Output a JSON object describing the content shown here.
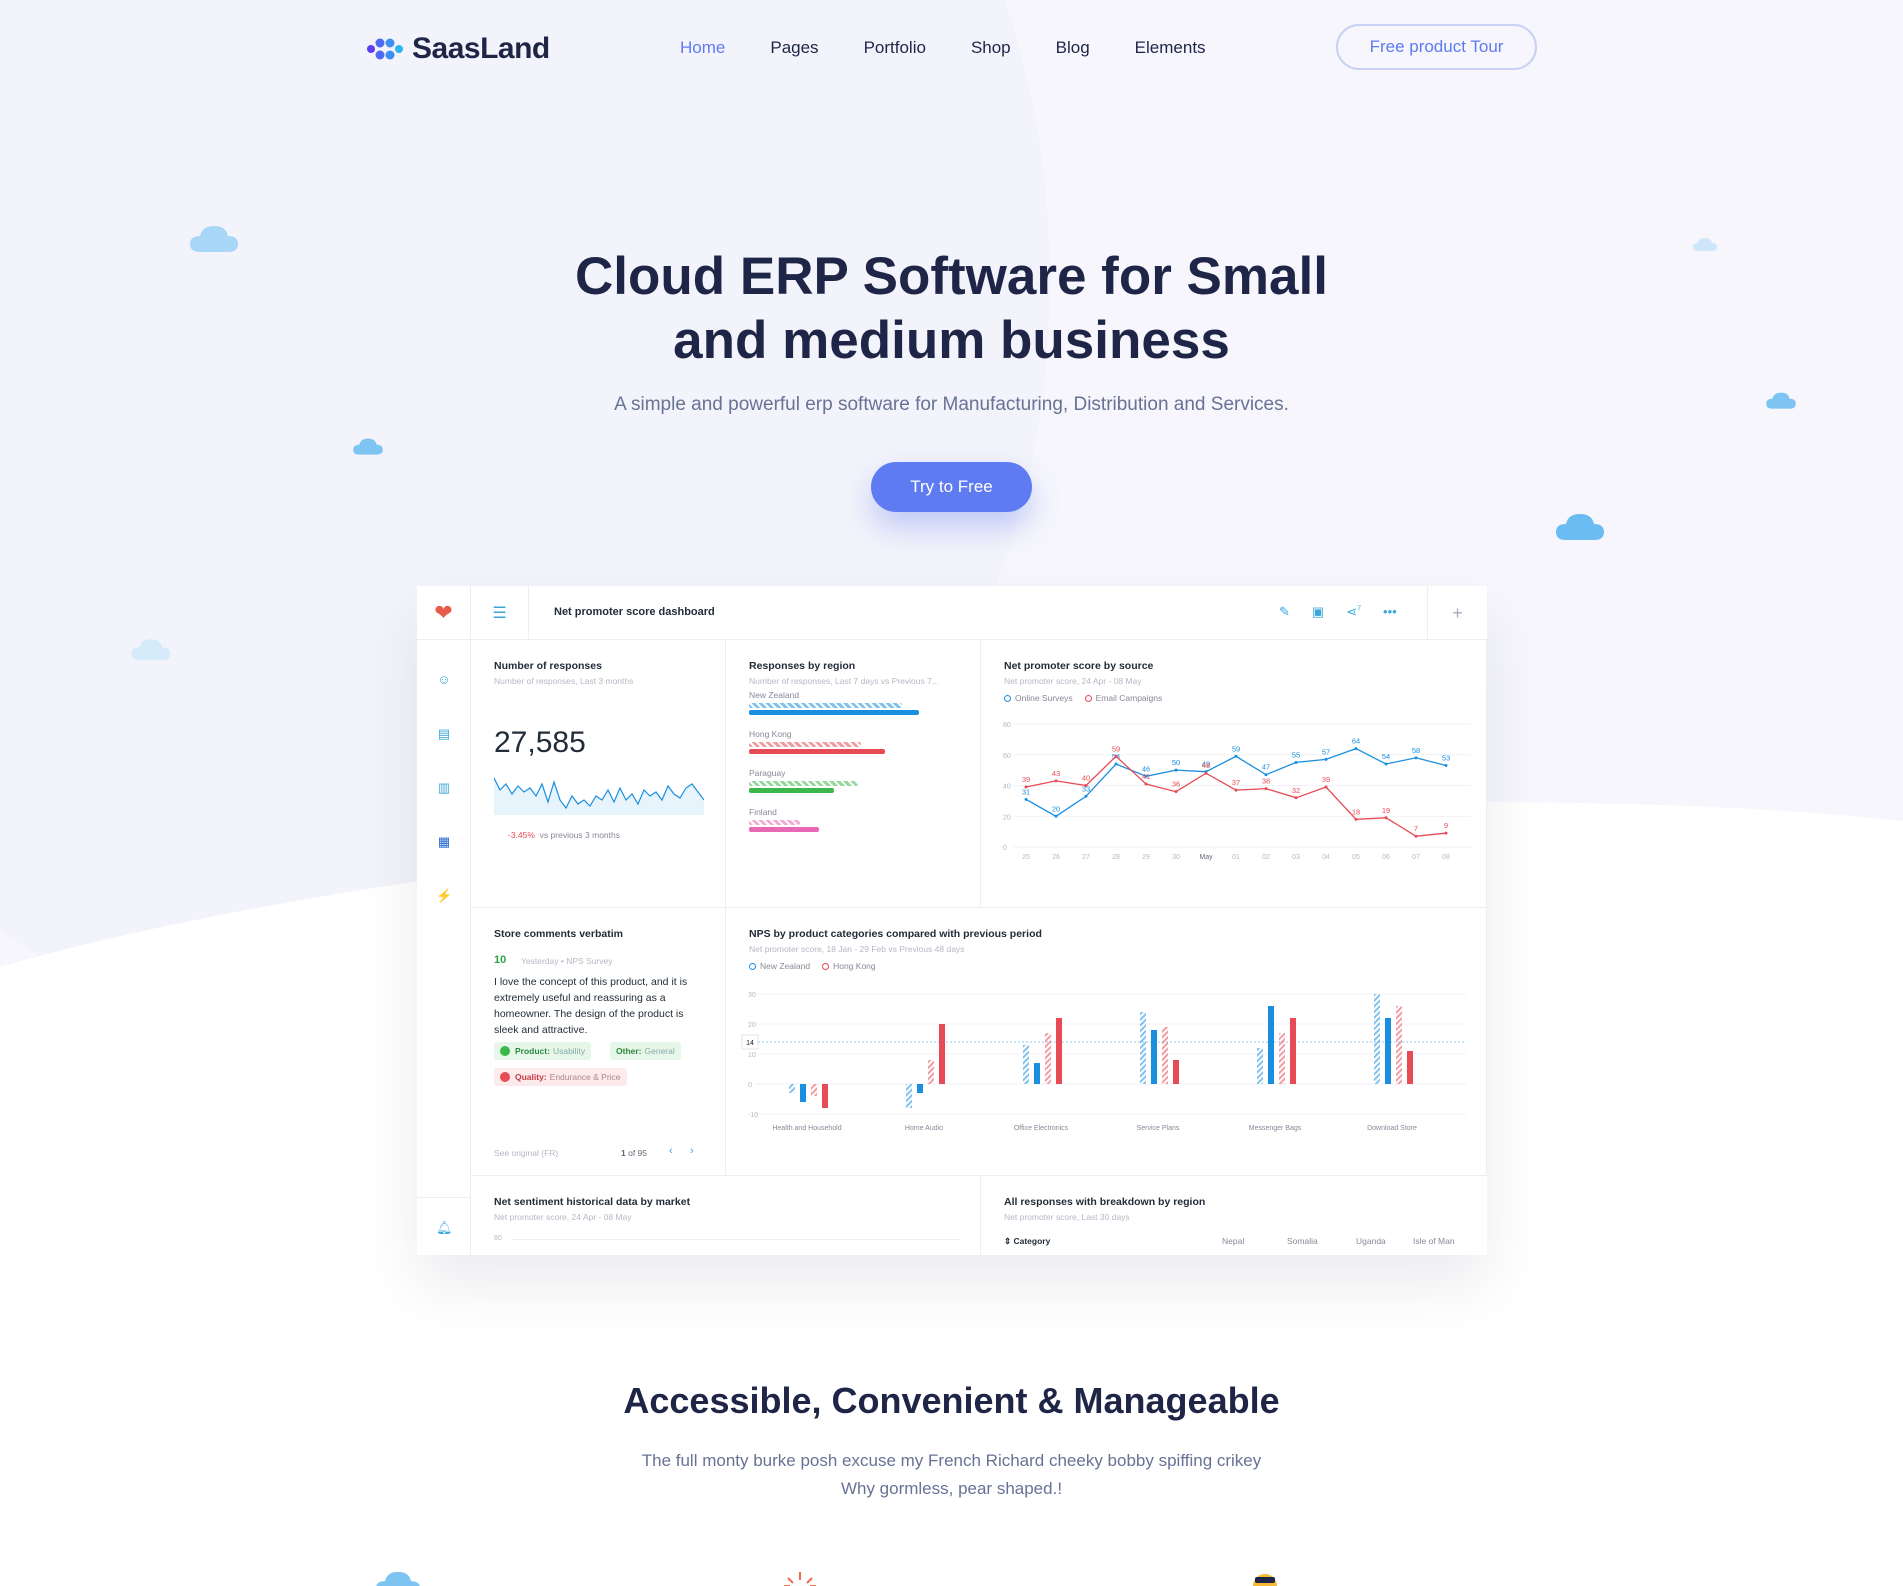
{
  "nav": {
    "brand": "SaasLand",
    "items": [
      {
        "label": "Home",
        "active": true
      },
      {
        "label": "Pages"
      },
      {
        "label": "Portfolio"
      },
      {
        "label": "Shop"
      },
      {
        "label": "Blog"
      },
      {
        "label": "Elements"
      }
    ],
    "cta": "Free product Tour"
  },
  "hero": {
    "title_line1": "Cloud ERP Software for Small",
    "title_line2": "and medium business",
    "subtitle": "A simple and powerful erp software for Manufacturing, Distribution and Services.",
    "button": "Try to Free"
  },
  "dashboard": {
    "title": "Net promoter score dashboard",
    "share_count": "7",
    "responses": {
      "title": "Number of responses",
      "subtitle": "Number of responses, Last 3 months",
      "value": "27,585",
      "delta": "-3.45%",
      "delta_text": "vs previous 3 months"
    },
    "regions": {
      "title": "Responses by region",
      "subtitle": "Number of responses, Last 7 days vs Previous 7...",
      "items": [
        {
          "label": "New Zealand",
          "color": "#1a8fe0",
          "value": 1.0,
          "prev": 0.9
        },
        {
          "label": "Hong Kong",
          "color": "#e84b55",
          "value": 0.8,
          "prev": 0.66
        },
        {
          "label": "Paraguay",
          "color": "#3cb84a",
          "value": 0.5,
          "prev": 0.64
        },
        {
          "label": "Finland",
          "color": "#e868b5",
          "value": 0.41,
          "prev": 0.3
        }
      ]
    },
    "nps_source": {
      "title": "Net promoter score by source",
      "subtitle": "Net promoter score, 24 Apr - 08 May",
      "legend": [
        "Online Surveys",
        "Email Campaigns"
      ]
    },
    "comments": {
      "title": "Store comments verbatim",
      "score": "10",
      "meta": "Yesterday  •  NPS Survey",
      "text": "I love the concept of this product, and it is extremely useful and reassuring as a homeowner. The design of the product is sleek and attractive.",
      "tags": [
        {
          "key": "Product:",
          "value": "Usability"
        },
        {
          "key": "Other:",
          "value": "General"
        },
        {
          "key": "Quality:",
          "value": "Endurance & Price"
        }
      ],
      "see_original": "See original (FR)",
      "page": "1",
      "page_total": "of 95"
    },
    "nps_categories": {
      "title": "NPS by product categories compared with previous period",
      "subtitle": "Net promoter score, 18 Jan - 29 Feb vs Previous 48 days",
      "legend": [
        "New Zealand",
        "Hong Kong"
      ]
    },
    "sentiment": {
      "title": "Net sentiment historical data by market",
      "subtitle": "Net promoter score, 24 Apr - 08 May",
      "tick": "80"
    },
    "breakdown": {
      "title": "All responses with breakdown by region",
      "subtitle": "Net promoter score, Last 30 days",
      "columns": [
        "Category",
        "Nepal",
        "Somalia",
        "Uganda",
        "Isle of Man"
      ]
    }
  },
  "section2": {
    "title": "Accessible, Convenient & Manageable",
    "subtitle_line1": "The full monty burke posh excuse my French Richard cheeky bobby spiffing crikey",
    "subtitle_line2": "Why gormless, pear shaped.!"
  },
  "chart_data": [
    {
      "type": "line",
      "title": "Net promoter score by source",
      "x": [
        "25",
        "26",
        "27",
        "28",
        "29",
        "30",
        "May",
        "01",
        "02",
        "03",
        "04",
        "05",
        "06",
        "07",
        "08"
      ],
      "ylim": [
        0,
        80
      ],
      "yticks": [
        0,
        20,
        40,
        60,
        80
      ],
      "series": [
        {
          "name": "Online Surveys",
          "color": "#1a8fe0",
          "values": [
            31,
            20,
            33,
            54,
            46,
            50,
            49,
            59,
            47,
            55,
            57,
            64,
            54,
            58,
            53
          ]
        },
        {
          "name": "Email Campaigns",
          "color": "#e84b55",
          "values": [
            39,
            43,
            40,
            59,
            41,
            36,
            48,
            37,
            38,
            32,
            39,
            18,
            19,
            7,
            9
          ]
        }
      ]
    },
    {
      "type": "bar",
      "title": "NPS by product categories compared with previous period",
      "categories": [
        "Health and Household",
        "Home Audio",
        "Office Electronics",
        "Service Plans",
        "Messenger Bags",
        "Download Store"
      ],
      "ylim": [
        -10,
        30
      ],
      "yticks": [
        -10,
        0,
        10,
        20,
        30
      ],
      "reference": 14,
      "series": [
        {
          "name": "New Zealand",
          "color": "#1a8fe0",
          "values": [
            -6,
            -3,
            7,
            18,
            26,
            22
          ]
        },
        {
          "name": "Hong Kong",
          "color": "#e84b55",
          "values": [
            -8,
            20,
            22,
            8,
            22,
            11
          ]
        }
      ],
      "previous": [
        {
          "name": "New Zealand",
          "values": [
            -3,
            -8,
            13,
            24,
            12,
            30
          ]
        },
        {
          "name": "Hong Kong",
          "values": [
            -4,
            8,
            17,
            19,
            17,
            26
          ]
        }
      ]
    },
    {
      "type": "line",
      "title": "Number of responses",
      "values": [
        52,
        40,
        46,
        36,
        44,
        38,
        42,
        34,
        46,
        28,
        48,
        30,
        22,
        34,
        26,
        30,
        24,
        34,
        30,
        40,
        28,
        42,
        30,
        36,
        26,
        40,
        34,
        38,
        30,
        44,
        36,
        32,
        42,
        46,
        38,
        30
      ]
    }
  ]
}
